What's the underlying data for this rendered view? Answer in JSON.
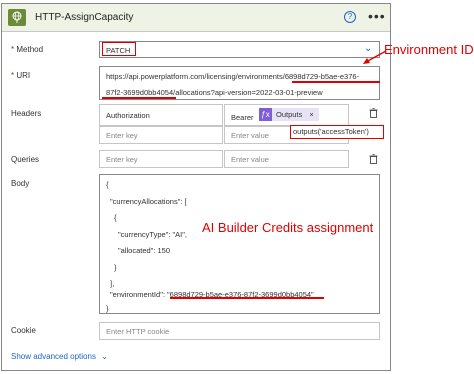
{
  "card": {
    "title": "HTTP-AssignCapacity",
    "help_icon": "?",
    "more_icon": "•••"
  },
  "method": {
    "required_mark": "*",
    "label": "Method",
    "value": "PATCH"
  },
  "uri": {
    "required_mark": "*",
    "label": "URI",
    "line1": "https://api.powerplatform.com/licensing/environments/6898d729-b5ae-e376-",
    "line2": "87f2-3699d0bb4054/allocations?api-version=2022-03-01-preview"
  },
  "headers": {
    "label": "Headers",
    "key1": "Authorization",
    "value1_prefix": "Bearer",
    "value1_token": "Outputs",
    "key_placeholder": "Enter key",
    "value_placeholder": "Enter value",
    "expression": "outputs('accessToken')"
  },
  "queries": {
    "label": "Queries",
    "key_placeholder": "Enter key",
    "value_placeholder": "Enter value"
  },
  "body": {
    "label": "Body",
    "lines": [
      "{",
      "\"currencyAllocations\": [",
      "{",
      "\"currencyType\": \"AI\",",
      "\"allocated\": 150",
      "}",
      "],",
      "\"environmentId\": \"6898d729-b5ae-e376-87f2-3699d0bb4054\"",
      "}"
    ]
  },
  "cookie": {
    "label": "Cookie",
    "placeholder": "Enter HTTP cookie"
  },
  "advanced": {
    "label": "Show advanced options",
    "icon": "⌄"
  },
  "annotations": {
    "environment_id": "Environment ID",
    "credits": "AI Builder Credits assignment"
  },
  "colors": {
    "accent": "#1f66c4",
    "annotation": "#e00000",
    "header_bg": "#eef3e6",
    "token_bg": "#e8e2f5"
  }
}
